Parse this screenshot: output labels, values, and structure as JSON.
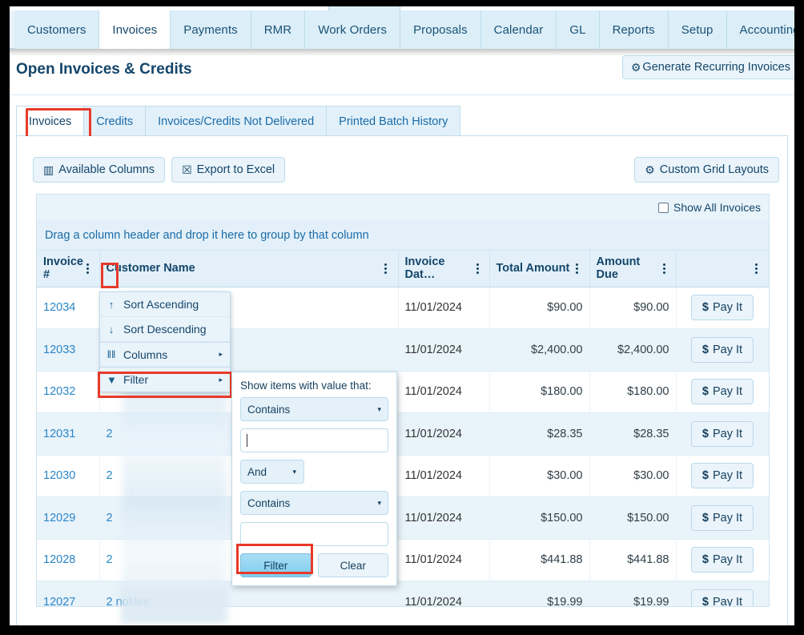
{
  "nav": {
    "items": [
      {
        "label": "Customers",
        "active": false,
        "caret": false
      },
      {
        "label": "Invoices",
        "active": true,
        "caret": false
      },
      {
        "label": "Payments",
        "active": false,
        "caret": false
      },
      {
        "label": "RMR",
        "active": false,
        "caret": false
      },
      {
        "label": "Work Orders",
        "active": false,
        "caret": false
      },
      {
        "label": "Proposals",
        "active": false,
        "caret": false
      },
      {
        "label": "Calendar",
        "active": false,
        "caret": false
      },
      {
        "label": "GL",
        "active": false,
        "caret": false
      },
      {
        "label": "Reports",
        "active": false,
        "caret": false
      },
      {
        "label": "Setup",
        "active": false,
        "caret": false
      },
      {
        "label": "Accounting",
        "active": false,
        "caret": true
      }
    ],
    "caret_glyph": "▾"
  },
  "header": {
    "title": "Open Invoices & Credits",
    "generate_recurring_label": "Generate Recurring Invoices",
    "gears_icon": "⚙"
  },
  "subtabs": [
    {
      "label": "Invoices",
      "active": true
    },
    {
      "label": "Credits",
      "active": false
    },
    {
      "label": "Invoices/Credits Not Delivered",
      "active": false
    },
    {
      "label": "Printed Batch History",
      "active": false
    }
  ],
  "toolbar": {
    "available_columns_label": "Available Columns",
    "available_columns_icon": "▥",
    "export_excel_label": "Export to Excel",
    "export_excel_icon": "☒",
    "custom_grid_layouts_label": "Custom Grid Layouts",
    "custom_grid_layouts_icon": "⚙"
  },
  "grid_options": {
    "show_all_label": "Show All Invoices",
    "show_all_checked": false,
    "group_hint": "Drag a column header and drop it here to group by that column"
  },
  "grid": {
    "columns": [
      {
        "label": "Invoice #",
        "align": "left"
      },
      {
        "label": "Customer Name",
        "align": "left"
      },
      {
        "label": "Invoice Dat…",
        "align": "left"
      },
      {
        "label": "Total Amount",
        "align": "right"
      },
      {
        "label": "Amount Due",
        "align": "right"
      },
      {
        "label": "",
        "align": "center"
      }
    ],
    "pay_label": "Pay It",
    "pay_icon": "$",
    "rows": [
      {
        "invoice": "12034",
        "customer": "",
        "date": "11/01/2024",
        "total": "$90.00",
        "due": "$90.00"
      },
      {
        "invoice": "12033",
        "customer": "",
        "date": "11/01/2024",
        "total": "$2,400.00",
        "due": "$2,400.00"
      },
      {
        "invoice": "12032",
        "customer": "",
        "date": "11/01/2024",
        "total": "$180.00",
        "due": "$180.00"
      },
      {
        "invoice": "12031",
        "customer": "2",
        "date": "11/01/2024",
        "total": "$28.35",
        "due": "$28.35"
      },
      {
        "invoice": "12030",
        "customer": "2",
        "date": "11/01/2024",
        "total": "$30.00",
        "due": "$30.00"
      },
      {
        "invoice": "12029",
        "customer": "2",
        "date": "11/01/2024",
        "total": "$150.00",
        "due": "$150.00"
      },
      {
        "invoice": "12028",
        "customer": "2",
        "date": "11/01/2024",
        "total": "$441.88",
        "due": "$441.88"
      },
      {
        "invoice": "12027",
        "customer": "2                        noklee",
        "date": "11/01/2024",
        "total": "$19.99",
        "due": "$19.99"
      }
    ]
  },
  "context_menu": {
    "items": [
      {
        "label": "Sort Ascending",
        "icon": "↑",
        "submenu": false
      },
      {
        "label": "Sort Descending",
        "icon": "↓",
        "submenu": false
      },
      {
        "label": "Columns",
        "icon": "‖‖",
        "submenu": true
      },
      {
        "label": "Filter",
        "icon": "▼",
        "submenu": true
      }
    ],
    "submenu_arrow": "▸"
  },
  "filter_popup": {
    "title": "Show items with value that:",
    "operator1": "Contains",
    "value1": "",
    "logic": "And",
    "operator2": "Contains",
    "value2": "",
    "filter_button": "Filter",
    "clear_button": "Clear",
    "dropdown_arrow": "▾"
  },
  "colors": {
    "accent": "#1a6ba8",
    "highlight": "#e8392a",
    "header_bg": "#e3f0f9",
    "link": "#2a86c8"
  }
}
